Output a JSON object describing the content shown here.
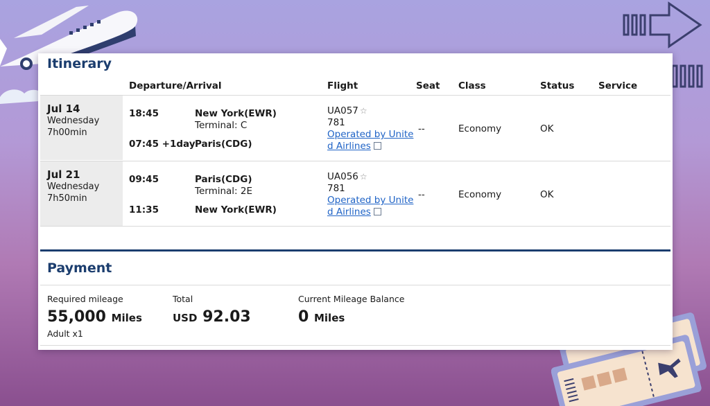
{
  "itinerary": {
    "title": "Itinerary",
    "headers": {
      "departure_arrival": "Departure/Arrival",
      "flight": "Flight",
      "seat": "Seat",
      "class": "Class",
      "status": "Status",
      "service": "Service"
    },
    "rows": [
      {
        "date": "Jul 14",
        "weekday": "Wednesday",
        "duration": "7h00min",
        "dep_time": "18:45",
        "dep_place": "New York(EWR)",
        "dep_terminal": "Terminal: C",
        "arr_time": "07:45 +1day",
        "arr_place": "Paris(CDG)",
        "flight_no": "UA057",
        "aircraft": "781",
        "operator_line1": "Operated by Unite",
        "operator_line2": "d Airlines",
        "seat": "--",
        "class": "Economy",
        "status": "OK"
      },
      {
        "date": "Jul 21",
        "weekday": "Wednesday",
        "duration": "7h50min",
        "dep_time": "09:45",
        "dep_place": "Paris(CDG)",
        "dep_terminal": "Terminal: 2E",
        "arr_time": "11:35",
        "arr_place": "New York(EWR)",
        "flight_no": "UA056",
        "aircraft": "781",
        "operator_line1": "Operated by Unite",
        "operator_line2": "d Airlines",
        "seat": "--",
        "class": "Economy",
        "status": "OK"
      }
    ]
  },
  "payment": {
    "title": "Payment",
    "required_label": "Required mileage",
    "required_value": "55,000",
    "required_unit": "Miles",
    "passengers": "Adult x1",
    "total_label": "Total",
    "total_currency": "USD",
    "total_value": "92.03",
    "balance_label": "Current Mileage Balance",
    "balance_value": "0",
    "balance_unit": "Miles"
  },
  "icons": {
    "star": "star-icon",
    "external": "external-link-icon"
  },
  "colors": {
    "heading": "#1b3d6e",
    "link": "#1f63c6",
    "divider": "#1b3d6e"
  }
}
